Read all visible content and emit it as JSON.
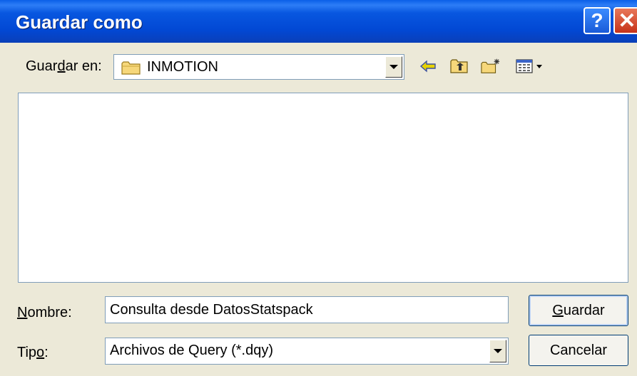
{
  "window": {
    "title": "Guardar como",
    "help_button": "?",
    "close_button": "✕"
  },
  "save_in": {
    "label": "Guardar en:",
    "folder": "INMOTION"
  },
  "toolbar": {
    "icons": [
      "back-arrow-icon",
      "up-folder-icon",
      "new-folder-icon",
      "view-menu-icon"
    ]
  },
  "name_field": {
    "label": "Nombre:",
    "value": "Consulta desde DatosStatspack"
  },
  "type_field": {
    "label": "Tipo:",
    "value": "Archivos de Query (*.dqy)"
  },
  "buttons": {
    "save": "Guardar",
    "cancel": "Cancelar"
  }
}
